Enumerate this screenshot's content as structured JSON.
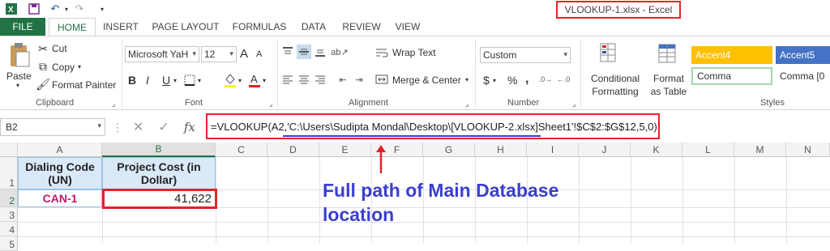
{
  "window": {
    "title": "VLOOKUP-1.xlsx - Excel"
  },
  "tabs": [
    "FILE",
    "HOME",
    "INSERT",
    "PAGE LAYOUT",
    "FORMULAS",
    "DATA",
    "REVIEW",
    "VIEW"
  ],
  "clipboard": {
    "paste": "Paste",
    "cut": "Cut",
    "copy": "Copy",
    "format_painter": "Format Painter",
    "label": "Clipboard"
  },
  "font": {
    "name": "Microsoft YaH",
    "size": "12",
    "label": "Font",
    "bold": "B",
    "italic": "I",
    "underline": "U",
    "grow": "A",
    "shrink": "A"
  },
  "alignment": {
    "wrap_text": "Wrap Text",
    "merge_center": "Merge & Center",
    "label": "Alignment"
  },
  "number": {
    "format": "Custom",
    "currency": "$",
    "percent": "%",
    "comma": ",",
    "label": "Number"
  },
  "styles": {
    "conditional_formatting": "Conditional Formatting",
    "format_as_table": "Format as Table",
    "label": "Styles",
    "cells": [
      "Accent4",
      "Accent5",
      "Comma",
      "Comma [0"
    ]
  },
  "formula_bar": {
    "name_box": "B2",
    "fx": "fx",
    "formula": "=VLOOKUP(A2,'C:\\Users\\Sudipta Mondal\\Desktop\\[VLOOKUP-2.xlsx]Sheet1'!$C$2:$G$12,5,0)"
  },
  "grid": {
    "columns": [
      "A",
      "B",
      "C",
      "D",
      "E",
      "F",
      "G",
      "H",
      "I",
      "J",
      "K",
      "L",
      "M",
      "N"
    ],
    "rows": [
      "1",
      "2",
      "3",
      "4",
      "5"
    ],
    "a1": "Dialing Code (UN)",
    "b1": "Project Cost (in Dollar)",
    "a2": "CAN-1",
    "b2": "41,622"
  },
  "annotation": "Full path of Main Database location",
  "colors": {
    "excel_green": "#217346",
    "highlight_red": "#e0252a",
    "annotation_blue": "#3a3fd1",
    "accent4": "#ffc000",
    "accent5": "#4472c4",
    "can_pink": "#c0186c"
  }
}
